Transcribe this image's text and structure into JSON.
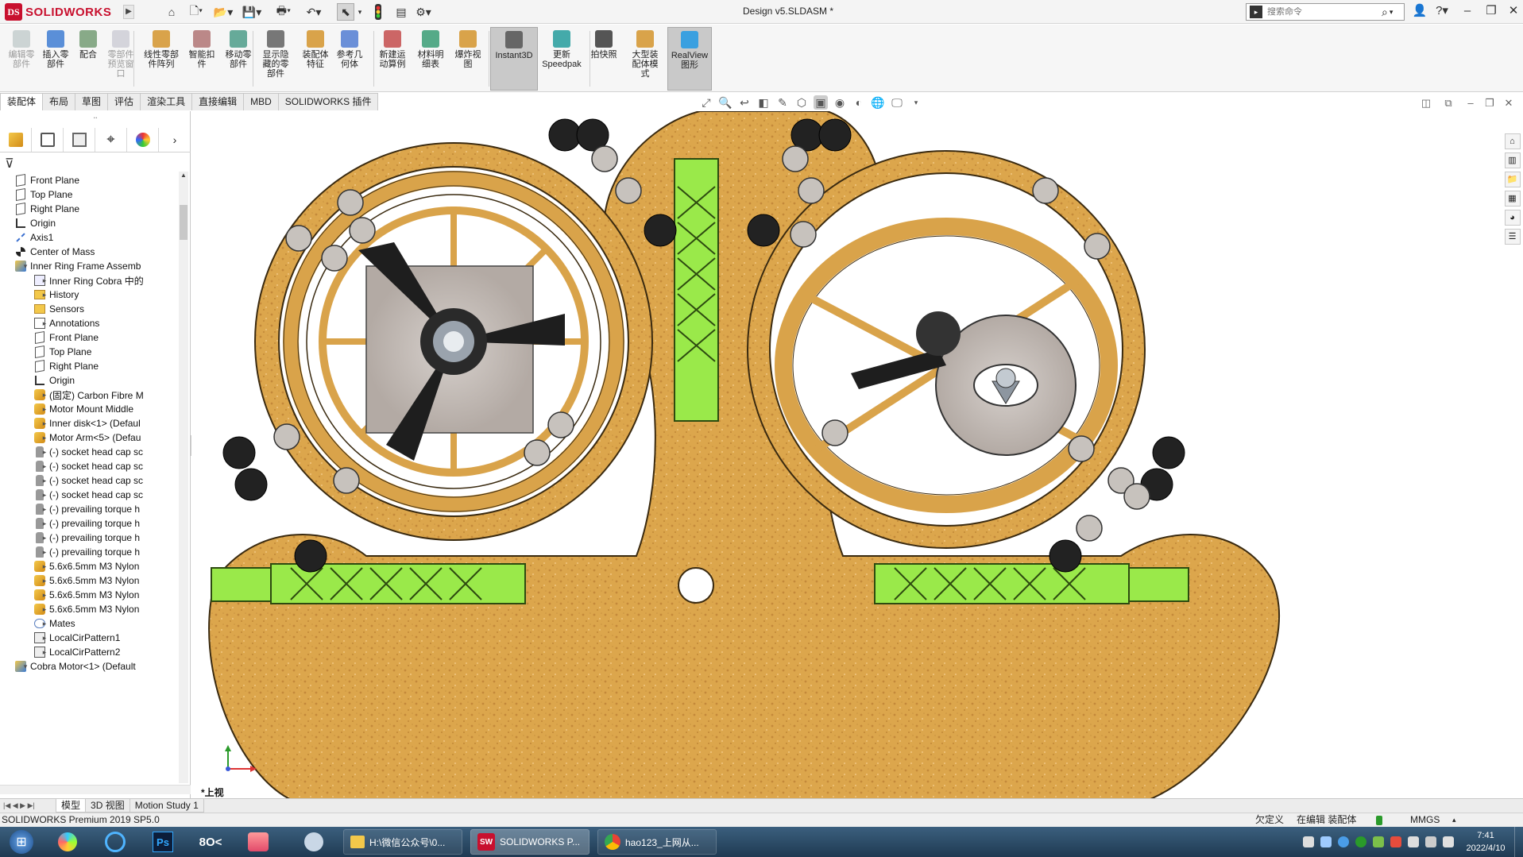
{
  "app": {
    "name": "SOLIDWORKS",
    "logo_mark": "DS",
    "document_title": "Design v5.SLDASM *",
    "search_placeholder": "搜索命令"
  },
  "ribbon": {
    "buttons": [
      {
        "label": "编辑零\n部件",
        "icon": "edit-component-icon",
        "disabled": true
      },
      {
        "label": "插入零\n部件",
        "icon": "insert-component-icon",
        "disabled": false
      },
      {
        "label": "配合",
        "icon": "mate-icon",
        "disabled": false
      },
      {
        "label": "零部件\n预览窗\n口",
        "icon": "component-preview-icon",
        "disabled": true
      },
      {
        "label": "线性零部\n件阵列",
        "icon": "linear-pattern-icon",
        "disabled": false
      },
      {
        "label": "智能扣\n件",
        "icon": "smart-fasteners-icon",
        "disabled": false
      },
      {
        "label": "移动零\n部件",
        "icon": "move-component-icon",
        "disabled": false
      },
      {
        "label": "显示隐\n藏的零\n部件",
        "icon": "show-hidden-icon",
        "disabled": false
      },
      {
        "label": "装配体\n特征",
        "icon": "assembly-features-icon",
        "disabled": false
      },
      {
        "label": "参考几\n何体",
        "icon": "reference-geometry-icon",
        "disabled": false
      },
      {
        "label": "新建运\n动算例",
        "icon": "new-motion-study-icon",
        "disabled": false
      },
      {
        "label": "材料明\n细表",
        "icon": "bom-icon",
        "disabled": false
      },
      {
        "label": "爆炸视\n图",
        "icon": "exploded-view-icon",
        "disabled": false
      },
      {
        "label": "Instant3D",
        "icon": "instant3d-icon",
        "disabled": false,
        "pressed": true
      },
      {
        "label": "更新\nSpeedpak",
        "icon": "speedpak-icon",
        "disabled": false
      },
      {
        "label": "拍快照",
        "icon": "snapshot-icon",
        "disabled": false
      },
      {
        "label": "大型装\n配体模\n式",
        "icon": "large-assembly-icon",
        "disabled": false
      },
      {
        "label": "RealView\n图形",
        "icon": "realview-icon",
        "disabled": false,
        "pressed": true
      }
    ]
  },
  "tabs": [
    "装配体",
    "布局",
    "草图",
    "评估",
    "渲染工具",
    "直接编辑",
    "MBD",
    "SOLIDWORKS 插件"
  ],
  "active_tab": 0,
  "feature_tree": {
    "items": [
      {
        "label": "Front Plane",
        "icon": "plane-icon",
        "indent": 1,
        "expander": ""
      },
      {
        "label": "Top Plane",
        "icon": "plane-icon",
        "indent": 1,
        "expander": ""
      },
      {
        "label": "Right Plane",
        "icon": "plane-icon",
        "indent": 1,
        "expander": ""
      },
      {
        "label": "Origin",
        "icon": "origin-icon",
        "indent": 1,
        "expander": ""
      },
      {
        "label": "Axis1",
        "icon": "axis-icon",
        "indent": 1,
        "expander": ""
      },
      {
        "label": "Center of Mass",
        "icon": "center-of-mass-icon",
        "indent": 1,
        "expander": ""
      },
      {
        "label": "Inner Ring Frame Assemb",
        "icon": "assembly-icon",
        "indent": 1,
        "expander": "▾"
      },
      {
        "label": "Inner Ring Cobra 中的",
        "icon": "history-box-icon",
        "indent": 2,
        "expander": "▸"
      },
      {
        "label": "History",
        "icon": "history-icon",
        "indent": 2,
        "expander": "▸"
      },
      {
        "label": "Sensors",
        "icon": "sensor-icon",
        "indent": 2,
        "expander": ""
      },
      {
        "label": "Annotations",
        "icon": "annotations-icon",
        "indent": 2,
        "expander": "▸"
      },
      {
        "label": "Front Plane",
        "icon": "plane-icon",
        "indent": 2,
        "expander": ""
      },
      {
        "label": "Top Plane",
        "icon": "plane-icon",
        "indent": 2,
        "expander": ""
      },
      {
        "label": "Right Plane",
        "icon": "plane-icon",
        "indent": 2,
        "expander": ""
      },
      {
        "label": "Origin",
        "icon": "origin-icon",
        "indent": 2,
        "expander": ""
      },
      {
        "label": "(固定) Carbon Fibre M",
        "icon": "part-icon",
        "indent": 2,
        "expander": "▸"
      },
      {
        "label": "Motor Mount Middle",
        "icon": "part-icon",
        "indent": 2,
        "expander": "▸"
      },
      {
        "label": "Inner disk<1> (Defaul",
        "icon": "part-icon",
        "indent": 2,
        "expander": "▸"
      },
      {
        "label": "Motor Arm<5> (Defau",
        "icon": "part-icon",
        "indent": 2,
        "expander": "▸"
      },
      {
        "label": "(-) socket head cap sc",
        "icon": "screw-icon",
        "indent": 2,
        "expander": "▸"
      },
      {
        "label": "(-) socket head cap sc",
        "icon": "screw-icon",
        "indent": 2,
        "expander": "▸"
      },
      {
        "label": "(-) socket head cap sc",
        "icon": "screw-icon",
        "indent": 2,
        "expander": "▸"
      },
      {
        "label": "(-) socket head cap sc",
        "icon": "screw-icon",
        "indent": 2,
        "expander": "▸"
      },
      {
        "label": "(-) prevailing torque h",
        "icon": "screw-icon",
        "indent": 2,
        "expander": "▸"
      },
      {
        "label": "(-) prevailing torque h",
        "icon": "screw-icon",
        "indent": 2,
        "expander": "▸"
      },
      {
        "label": "(-) prevailing torque h",
        "icon": "screw-icon",
        "indent": 2,
        "expander": "▸"
      },
      {
        "label": "(-) prevailing torque h",
        "icon": "screw-icon",
        "indent": 2,
        "expander": "▸"
      },
      {
        "label": "5.6x6.5mm M3 Nylon",
        "icon": "part-icon",
        "indent": 2,
        "expander": "▸"
      },
      {
        "label": "5.6x6.5mm M3 Nylon",
        "icon": "part-icon",
        "indent": 2,
        "expander": "▸"
      },
      {
        "label": "5.6x6.5mm M3 Nylon",
        "icon": "part-icon",
        "indent": 2,
        "expander": "▸"
      },
      {
        "label": "5.6x6.5mm M3 Nylon",
        "icon": "part-icon",
        "indent": 2,
        "expander": "▸"
      },
      {
        "label": "Mates",
        "icon": "mates-icon",
        "indent": 2,
        "expander": "▸"
      },
      {
        "label": "LocalCirPattern1",
        "icon": "pattern-icon",
        "indent": 2,
        "expander": "▸"
      },
      {
        "label": "LocalCirPattern2",
        "icon": "pattern-icon",
        "indent": 2,
        "expander": "▸"
      },
      {
        "label": "Cobra Motor<1> (Default",
        "icon": "assembly-icon",
        "indent": 1,
        "expander": "▾"
      }
    ]
  },
  "viewport": {
    "view_label": "*上视"
  },
  "bottom_tabs": [
    "模型",
    "3D 视图",
    "Motion Study 1"
  ],
  "active_bottom_tab": 0,
  "status": {
    "product": "SOLIDWORKS Premium 2019 SP5.0",
    "defined": "欠定义",
    "editing": "在编辑 装配体",
    "units": "MMGS"
  },
  "taskbar": {
    "tasks": [
      {
        "label": "H:\\微信公众号\\0...",
        "icon": "folder-icon"
      },
      {
        "label": "SOLIDWORKS P...",
        "icon": "solidworks-icon",
        "active": true
      },
      {
        "label": "hao123_上网从...",
        "icon": "chrome-icon"
      }
    ],
    "time": "7:41",
    "date": "2022/4/10"
  },
  "colors": {
    "brand_red": "#c8102e",
    "wood": "#d9a34a",
    "green_arm": "#9ae94a",
    "taskbar": "#2b4a66"
  }
}
